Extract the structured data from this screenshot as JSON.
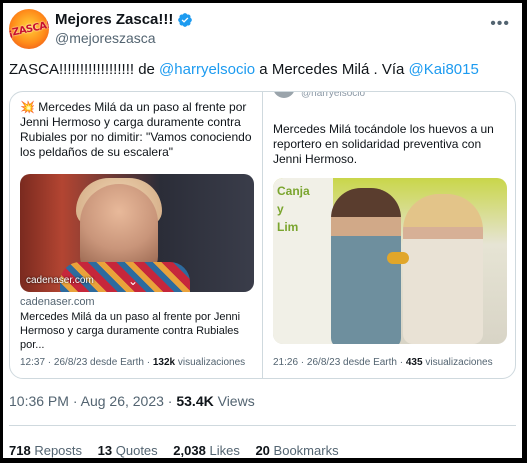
{
  "account": {
    "avatar_text": "¡ZASCA!",
    "display_name": "Mejores Zasca!!!",
    "handle": "@mejoreszasca"
  },
  "tweet": {
    "prefix": "ZASCA!!!!!!!!!!!!!!!!!! de ",
    "mention1": "@harryelsocio",
    "middle": " a Mercedes Milá . Vía ",
    "mention2": "@Kai8015"
  },
  "quote1": {
    "text": "💥 Mercedes Milá da un paso al frente por Jenni Hermoso y carga duramente contra Rubiales por no dimitir: \"Vamos conociendo los peldaños de su escalera\"",
    "media_caption": "cadenaser.com",
    "link_domain": "cadenaser.com",
    "link_title": "Mercedes Milá da un paso al frente por Jenni Hermoso y carga duramente contra Rubiales por...",
    "meta_time": "12:37 · 26/8/23 desde Earth · ",
    "meta_views_count": "132k",
    "meta_views_label": " visualizaciones"
  },
  "quote2": {
    "handle": "@harryelsocio",
    "text": "Mercedes Milá tocándole los huevos a un reportero en solidaridad preventiva con Jenni Hermoso.",
    "banner_text": [
      "Canja",
      "y",
      "Lim"
    ],
    "meta_time": "21:26 · 26/8/23 desde Earth · ",
    "meta_views_count": "435",
    "meta_views_label": " visualizaciones"
  },
  "timestamp": {
    "time": "10:36 PM",
    "sep": " · ",
    "date": "Aug 26, 2023",
    "dot": " · ",
    "views_count": "53.4K",
    "views_label": " Views"
  },
  "stats": [
    {
      "count": "718",
      "label": "Reposts"
    },
    {
      "count": "13",
      "label": "Quotes"
    },
    {
      "count": "2,038",
      "label": "Likes"
    },
    {
      "count": "20",
      "label": "Bookmarks"
    }
  ],
  "colors": {
    "link": "#1d9bf0",
    "muted": "#536471",
    "border": "#cfd9de"
  }
}
